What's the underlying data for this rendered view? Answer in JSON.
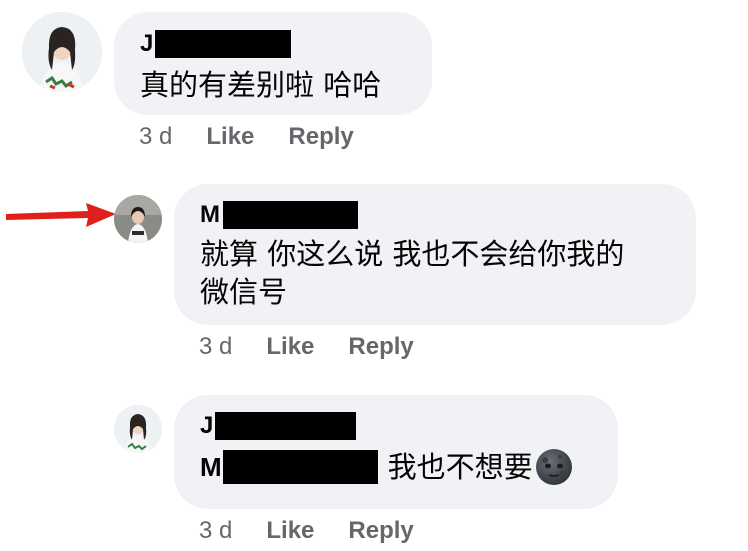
{
  "comments": [
    {
      "author_initial": "J",
      "text": "真的有差别啦 哈哈",
      "time": "3 d",
      "like_label": "Like",
      "reply_label": "Reply"
    },
    {
      "author_initial": "M",
      "text_line1": "就算 你这么说 我也不会给你我的",
      "text_line2": "微信号",
      "time": "3 d",
      "like_label": "Like",
      "reply_label": "Reply"
    },
    {
      "author_initial": "J",
      "mention_initial": "M",
      "text": "我也不想要",
      "emoji": "new-moon-face",
      "time": "3 d",
      "like_label": "Like",
      "reply_label": "Reply"
    }
  ],
  "annotation": {
    "arrow_color": "#e0201b"
  },
  "colors": {
    "bubble_bg": "#f0f2f5",
    "meta_text": "#65676b",
    "redaction": "#000000"
  }
}
